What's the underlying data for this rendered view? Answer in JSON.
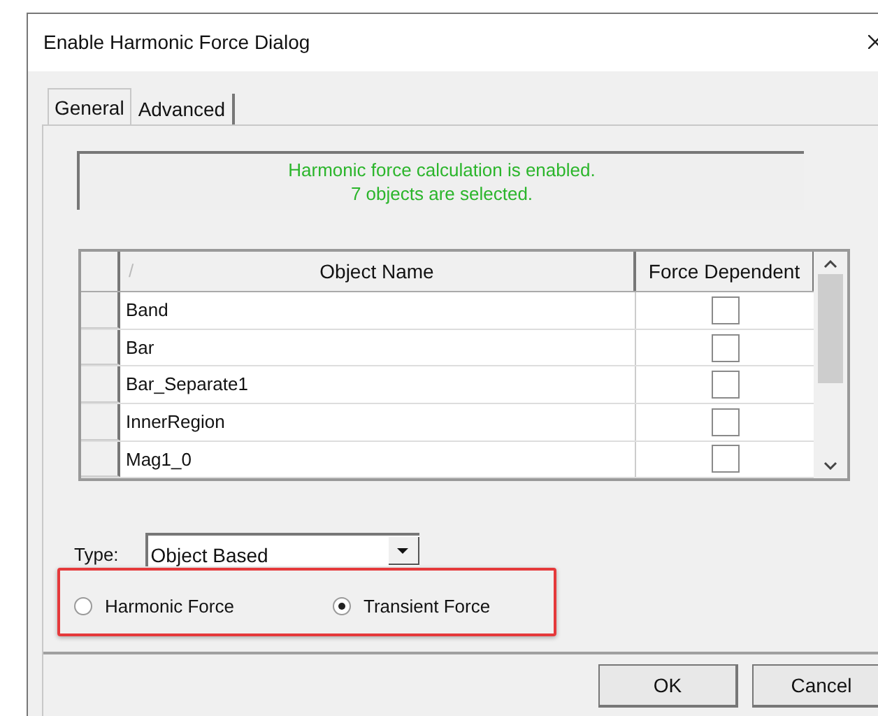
{
  "window": {
    "title": "Enable Harmonic Force Dialog"
  },
  "tabs": [
    {
      "label": "General",
      "selected": true
    },
    {
      "label": "Advanced",
      "selected": false
    }
  ],
  "status": {
    "lines": [
      "Harmonic force calculation is enabled.",
      "7 objects are selected."
    ]
  },
  "table": {
    "sort_mark": "/",
    "columns": [
      "Object Name",
      "Force Dependent"
    ],
    "rows": [
      {
        "name": "Band",
        "checked": false
      },
      {
        "name": "Bar",
        "checked": false
      },
      {
        "name": "Bar_Separate1",
        "checked": false
      },
      {
        "name": "InnerRegion",
        "checked": false
      },
      {
        "name": "Mag1_0",
        "checked": false
      }
    ]
  },
  "type": {
    "label": "Type:",
    "value": "Object Based"
  },
  "force_options": [
    {
      "label": "Harmonic Force",
      "selected": false
    },
    {
      "label": "Transient Force",
      "selected": true
    }
  ],
  "buttons": [
    "OK",
    "Cancel"
  ]
}
